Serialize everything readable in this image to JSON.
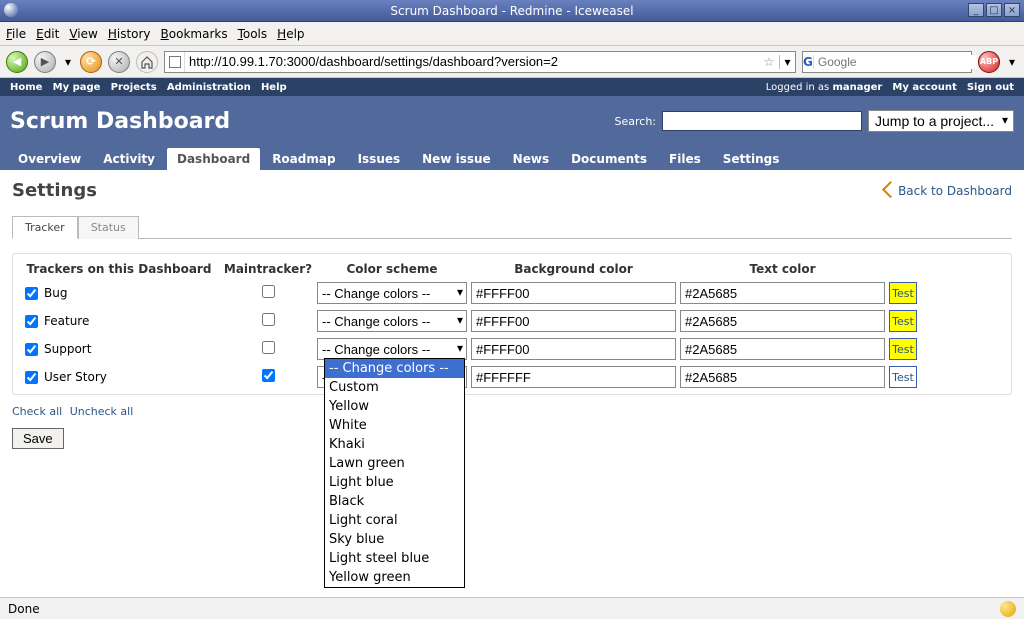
{
  "window_title": "Scrum Dashboard - Redmine - Iceweasel",
  "browser_menu": [
    "File",
    "Edit",
    "View",
    "History",
    "Bookmarks",
    "Tools",
    "Help"
  ],
  "url": "http://10.99.1.70:3000/dashboard/settings/dashboard?version=2",
  "search_placeholder": "Google",
  "redmine_top_left": [
    "Home",
    "My page",
    "Projects",
    "Administration",
    "Help"
  ],
  "logged_in_text": "Logged in as ",
  "logged_in_user": "manager",
  "redmine_top_right": [
    "My account",
    "Sign out"
  ],
  "app_title": "Scrum Dashboard",
  "header_search_label": "Search:",
  "jump_label": "Jump to a project...",
  "main_nav": [
    "Overview",
    "Activity",
    "Dashboard",
    "Roadmap",
    "Issues",
    "New issue",
    "News",
    "Documents",
    "Files",
    "Settings"
  ],
  "main_nav_active": "Dashboard",
  "page_heading": "Settings",
  "back_link": "Back to Dashboard",
  "subtabs": [
    "Tracker",
    "Status"
  ],
  "subtab_active": "Tracker",
  "columns": {
    "trackers": "Trackers on this Dashboard",
    "maintracker": "Maintracker?",
    "scheme": "Color scheme",
    "bg": "Background color",
    "text": "Text color"
  },
  "select_default": "-- Change colors --",
  "trackers": [
    {
      "name": "Bug",
      "on": true,
      "main": false,
      "bg": "#FFFF00",
      "tx": "#2A5685",
      "test_bg": "#FFFF00"
    },
    {
      "name": "Feature",
      "on": true,
      "main": false,
      "bg": "#FFFF00",
      "tx": "#2A5685",
      "test_bg": "#FFFF00"
    },
    {
      "name": "Support",
      "on": true,
      "main": false,
      "bg": "#FFFF00",
      "tx": "#2A5685",
      "test_bg": "#FFFF00"
    },
    {
      "name": "User Story",
      "on": true,
      "main": true,
      "bg": "#FFFFFF",
      "tx": "#2A5685",
      "test_bg": "#FFFFFF"
    }
  ],
  "test_label": "Test",
  "check_all": "Check all",
  "uncheck_all": "Uncheck all",
  "save_label": "Save",
  "dropdown_options": [
    "-- Change colors --",
    "Custom",
    "Yellow",
    "White",
    "Khaki",
    "Lawn green",
    "Light blue",
    "Black",
    "Light coral",
    "Sky blue",
    "Light steel blue",
    "Yellow green"
  ],
  "status_text": "Done"
}
